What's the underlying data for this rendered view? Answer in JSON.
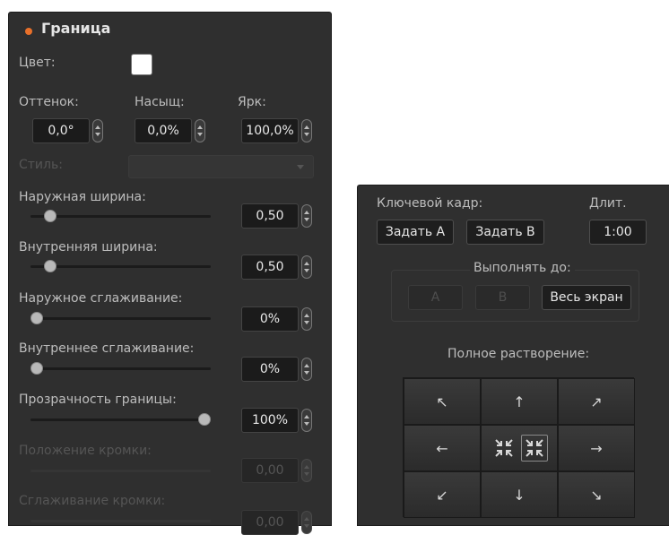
{
  "border_panel": {
    "title": "Граница",
    "color_label": "Цвет:",
    "color_value": "#ffffff",
    "hue_label": "Оттенок:",
    "hue_value": "0,0°",
    "sat_label": "Насыщ:",
    "sat_value": "0,0%",
    "lum_label": "Ярк:",
    "lum_value": "100,0%",
    "style_label": "Стиль:",
    "outer_width": {
      "label": "Наружная ширина:",
      "value": "0,50",
      "level": 0.08
    },
    "inner_width": {
      "label": "Внутренняя ширина:",
      "value": "0,50",
      "level": 0.08
    },
    "outer_soften": {
      "label": "Наружное сглаживание:",
      "value": "0%",
      "level": 0.0
    },
    "inner_soften": {
      "label": "Внутреннее сглаживание:",
      "value": "0%",
      "level": 0.0
    },
    "border_opacity": {
      "label": "Прозрачность границы:",
      "value": "100%",
      "level": 1.0
    },
    "bevel_position": {
      "label": "Положение кромки:",
      "value": "0,00"
    },
    "bevel_soften": {
      "label": "Сглаживание кромки:",
      "value": "0,00"
    }
  },
  "keyframe_panel": {
    "keyframe_label": "Ключевой кадр:",
    "set_a_label": "Задать A",
    "set_b_label": "Задать B",
    "duration_label": "Длит.",
    "duration_value": "1:00",
    "run_to_label": "Выполнять до:",
    "run_a_label": "A",
    "run_b_label": "B",
    "full_screen_label": "Весь экран",
    "full_dissolve_label": "Полное растворение:"
  },
  "icons": {
    "up_left": "↖",
    "up": "↑",
    "up_right": "↗",
    "left": "←",
    "right": "→",
    "down_left": "↙",
    "down": "↓",
    "down_right": "↘"
  }
}
